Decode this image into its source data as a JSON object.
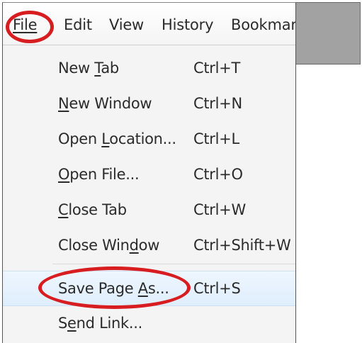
{
  "menubar": {
    "file": "File",
    "edit": "Edit",
    "view": "View",
    "history": "History",
    "bookmarks": "Bookmar"
  },
  "file_menu": [
    {
      "label": "New Tab",
      "shortcut": "Ctrl+T",
      "mnemonic_pre": "New ",
      "mnemonic": "T",
      "mnemonic_post": "ab"
    },
    {
      "label": "New Window",
      "shortcut": "Ctrl+N",
      "mnemonic_pre": "",
      "mnemonic": "N",
      "mnemonic_post": "ew Window"
    },
    {
      "label": "Open Location...",
      "shortcut": "Ctrl+L",
      "mnemonic_pre": "Open ",
      "mnemonic": "L",
      "mnemonic_post": "ocation..."
    },
    {
      "label": "Open File...",
      "shortcut": "Ctrl+O",
      "mnemonic_pre": "",
      "mnemonic": "O",
      "mnemonic_post": "pen File..."
    },
    {
      "label": "Close Tab",
      "shortcut": "Ctrl+W",
      "mnemonic_pre": "",
      "mnemonic": "C",
      "mnemonic_post": "lose Tab"
    },
    {
      "label": "Close Window",
      "shortcut": "Ctrl+Shift+W",
      "mnemonic_pre": "Close Win",
      "mnemonic": "d",
      "mnemonic_post": "ow"
    },
    {
      "label": "Save Page As...",
      "shortcut": "Ctrl+S",
      "mnemonic_pre": "Save Page ",
      "mnemonic": "A",
      "mnemonic_post": "s..."
    },
    {
      "label": "Send Link...",
      "shortcut": "",
      "mnemonic_pre": "S",
      "mnemonic": "e",
      "mnemonic_post": "nd Link..."
    }
  ],
  "colors": {
    "annotation_circle": "#d81d20",
    "menu_background": "#f4f4f4",
    "highlight": "#dfeefc"
  }
}
